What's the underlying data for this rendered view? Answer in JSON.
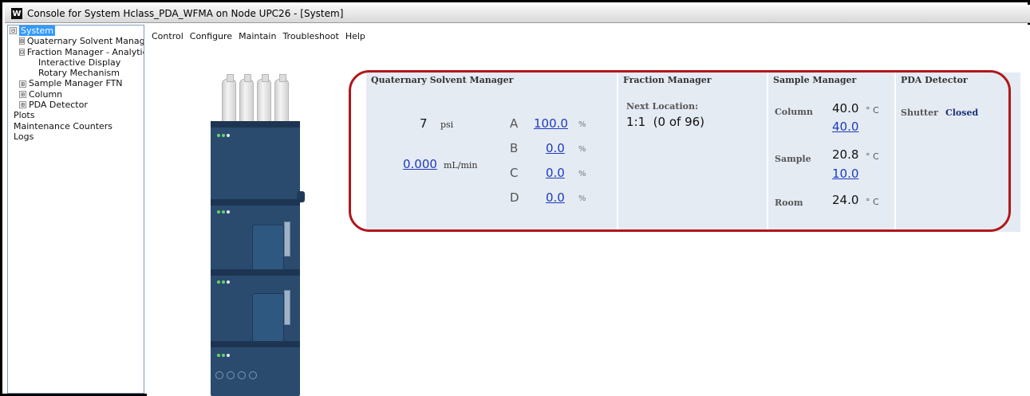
{
  "window": {
    "title": "Console for System Hclass_PDA_WFMA on Node UPC26 - [System]",
    "icon_letter": "W"
  },
  "tree": {
    "items": [
      {
        "label": "System",
        "expander": "⊟"
      },
      {
        "label": "Quaternary Solvent Manag",
        "expander": "⊞"
      },
      {
        "label": "Fraction Manager - Analytic",
        "expander": "⊟"
      },
      {
        "label": "Interactive Display",
        "expander": ""
      },
      {
        "label": "Rotary Mechanism",
        "expander": ""
      },
      {
        "label": "Sample Manager FTN",
        "expander": "⊞"
      },
      {
        "label": "Column",
        "expander": "⊞"
      },
      {
        "label": "PDA Detector",
        "expander": "⊞"
      },
      {
        "label": "Plots",
        "expander": ""
      },
      {
        "label": "Maintenance Counters",
        "expander": ""
      },
      {
        "label": "Logs",
        "expander": ""
      }
    ]
  },
  "menu": {
    "control": "Control",
    "configure": "Configure",
    "maintain": "Maintain",
    "troubleshoot": "Troubleshoot",
    "help": "Help"
  },
  "qsm": {
    "header": "Quaternary Solvent Manager",
    "pressure_value": "7",
    "pressure_unit": "psi",
    "flow_value": "0.000",
    "flow_unit": "mL/min",
    "solvents": [
      {
        "letter": "A",
        "value": "100.0",
        "unit": "%"
      },
      {
        "letter": "B",
        "value": "0.0",
        "unit": "%"
      },
      {
        "letter": "C",
        "value": "0.0",
        "unit": "%"
      },
      {
        "letter": "D",
        "value": "0.0",
        "unit": "%"
      }
    ]
  },
  "fm": {
    "header": "Fraction Manager",
    "next_label": "Next Location:",
    "next_value": "1:1  (0 of 96)"
  },
  "sm": {
    "header": "Sample Manager",
    "column_label": "Column",
    "column_actual": "40.0",
    "column_setpoint": "40.0",
    "sample_label": "Sample",
    "sample_actual": "20.8",
    "sample_setpoint": "10.0",
    "room_label": "Room",
    "room_value": "24.0",
    "unit": "° C"
  },
  "pda": {
    "header": "PDA Detector",
    "shutter_label": "Shutter",
    "shutter_value": "Closed"
  },
  "colors": {
    "highlight_outline": "#b0171c",
    "link": "#1d3bbd",
    "tree_selection": "#3399ff",
    "instrument_body": "#2a4b6e"
  }
}
